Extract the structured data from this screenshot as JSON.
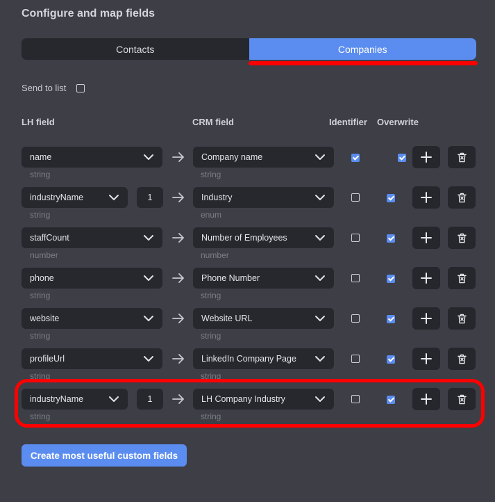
{
  "title": "Configure and map fields",
  "tabs": [
    "Contacts",
    "Companies"
  ],
  "send_to_list": "Send to list",
  "headers": {
    "lh": "LH field",
    "crm": "CRM field",
    "identifier": "Identifier",
    "overwrite": "Overwrite"
  },
  "rows": [
    {
      "lh": "name",
      "lh_type": "string",
      "crm": "Company name",
      "crm_type": "string",
      "identifier": true,
      "overwrite": true
    },
    {
      "lh": "industryName",
      "index": "1",
      "lh_type": "string",
      "crm": "Industry",
      "crm_type": "enum",
      "identifier": false,
      "overwrite": true
    },
    {
      "lh": "staffCount",
      "lh_type": "number",
      "crm": "Number of Employees",
      "crm_type": "number",
      "identifier": false,
      "overwrite": true
    },
    {
      "lh": "phone",
      "lh_type": "string",
      "crm": "Phone Number",
      "crm_type": "string",
      "identifier": false,
      "overwrite": true
    },
    {
      "lh": "website",
      "lh_type": "string",
      "crm": "Website URL",
      "crm_type": "string",
      "identifier": false,
      "overwrite": true
    },
    {
      "lh": "profileUrl",
      "lh_type": "string",
      "crm": "LinkedIn Company Page",
      "crm_type": "string",
      "identifier": false,
      "overwrite": true
    },
    {
      "lh": "industryName",
      "index": "1",
      "lh_type": "string",
      "crm": "LH Company Industry",
      "crm_type": "string",
      "identifier": false,
      "overwrite": true
    }
  ],
  "create_button": "Create most useful custom fields",
  "colors": {
    "accent": "#5b8df0",
    "highlight": "#ff0000",
    "background": "#3d3e46"
  }
}
